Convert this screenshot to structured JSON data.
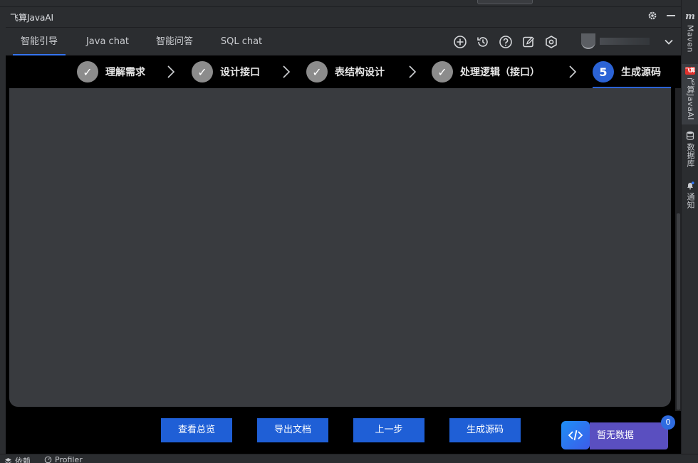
{
  "window": {
    "title": "飞算JavaAI"
  },
  "tabs": [
    {
      "label": "智能引导",
      "active": true
    },
    {
      "label": "Java chat",
      "active": false
    },
    {
      "label": "智能问答",
      "active": false
    },
    {
      "label": "SQL chat",
      "active": false
    }
  ],
  "toolbar_icons": [
    "add-icon",
    "history-icon",
    "help-icon",
    "edit-icon",
    "settings-hex-icon"
  ],
  "steps": [
    {
      "label": "理解需求",
      "status": "done",
      "mark": "✓"
    },
    {
      "label": "设计接口",
      "status": "done",
      "mark": "✓"
    },
    {
      "label": "表结构设计",
      "status": "done",
      "mark": "✓"
    },
    {
      "label": "处理逻辑（接口）",
      "status": "done",
      "mark": "✓"
    },
    {
      "label": "生成源码",
      "status": "current",
      "mark": "5"
    }
  ],
  "actions": {
    "overview": "查看总览",
    "export_doc": "导出文档",
    "prev_step": "上一步",
    "generate_code": "生成源码"
  },
  "code_widget": {
    "label": "暂无数据",
    "badge": "0"
  },
  "right_sidebar": {
    "maven": "Maven",
    "feisuan_logo": "飞算",
    "feisuan": "飞算JavaAI",
    "database": "数据库",
    "notifications": "通知"
  },
  "status_bar": {
    "item1": "依赖",
    "item2": "Profiler"
  },
  "colors": {
    "accent": "#3574f0",
    "button": "#1f5fd6",
    "step_done": "#8c8c8c",
    "step_current": "#2b63d6",
    "panel": "#393b3f",
    "widget_label": "#5a4fc0"
  }
}
